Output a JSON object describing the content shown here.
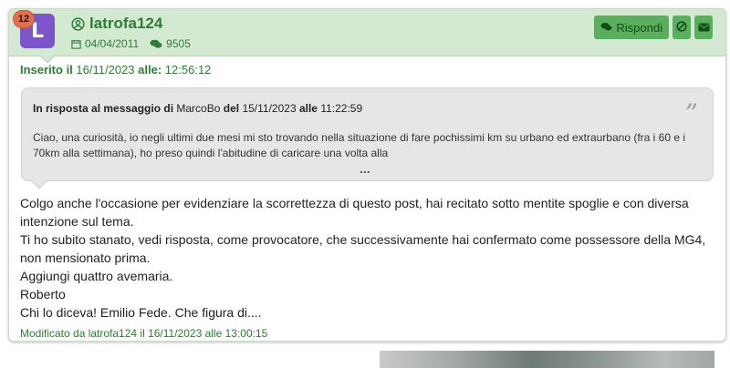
{
  "post": {
    "badge": "12",
    "avatar_letter": "L",
    "username": "latrofa124",
    "join_date": "04/04/2011",
    "message_count": "9505",
    "reply_label": "Rispondi",
    "inserted": {
      "label": "Inserito il",
      "date": "16/11/2023",
      "time_label": "alle:",
      "time": "12:56:12"
    },
    "quote": {
      "lead": "In risposta al messaggio di",
      "author": "MarcoBo",
      "del": "del",
      "date": "15/11/2023",
      "alle": "alle",
      "time": "11:22:59",
      "mark": "”",
      "text": "Ciao,  una curiosità, io negli ultimi due mesi mi sto trovando nella situazione di fare pochissimi km su urbano ed extraurbano (fra i 60 e i 70km alla settimana), ho preso quindi l'abitudine di caricare una volta alla",
      "more": "..."
    },
    "body_lines": [
      "Colgo anche l'occasione per evidenziare la scorrettezza di questo post, hai recitato sotto mentite spoglie e con diversa intenzione sul tema.",
      "Ti ho subito stanato, vedi risposta, come provocatore, che successivamente hai confermato come possessore della MG4, non mensionato prima.",
      "Aggiungi quattro avemaria.",
      "Roberto",
      "Chi lo diceva! Emilio Fede. Che figura di...."
    ],
    "edited": "Modificato da latrofa124 il 16/11/2023 alle 13:00:15"
  },
  "colors": {
    "header_bg": "#d4e9d2",
    "accent_green": "#2e7d32",
    "button_green": "#5cae5f",
    "avatar_purple": "#7b55c9",
    "badge_orange": "#e2704f",
    "quote_bg": "#e6e6e6"
  },
  "icons": [
    "user-circle-icon",
    "calendar-icon",
    "comments-icon",
    "reply-icon",
    "ban-icon",
    "envelope-icon"
  ]
}
